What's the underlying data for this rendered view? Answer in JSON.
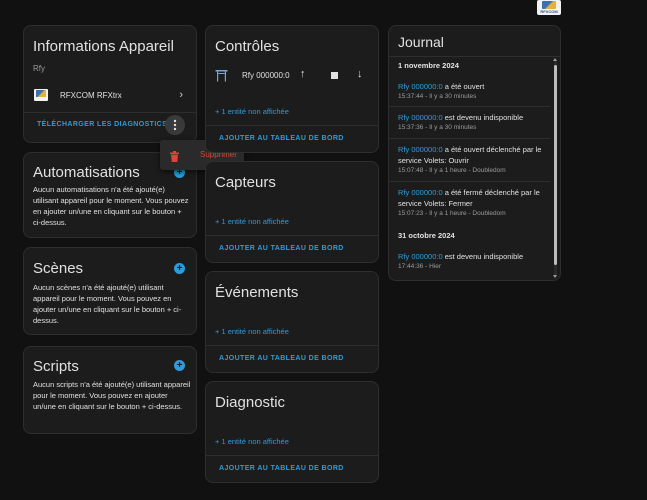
{
  "top_logo_label": "RFXCOM",
  "info_card": {
    "title": "Informations Appareil",
    "model": "Rfy",
    "device_name": "RFXCOM RFXtrx",
    "download_label": "TÉLÉCHARGER LES DIAGNOSTICS"
  },
  "menu": {
    "delete_label": "Supprimer"
  },
  "automations": {
    "title": "Automatisations",
    "text": "Aucun automatisations n'a été ajouté(e) utilisant appareil pour le moment. Vous pouvez en ajouter un/une en cliquant sur le bouton + ci-dessus."
  },
  "scenes": {
    "title": "Scènes",
    "text": "Aucun scènes n'a été ajouté(e) utilisant appareil pour le moment. Vous pouvez en ajouter un/une en cliquant sur le bouton + ci-dessus."
  },
  "scripts": {
    "title": "Scripts",
    "text": "Aucun scripts n'a été ajouté(e) utilisant appareil pour le moment. Vous pouvez en ajouter un/une en cliquant sur le bouton + ci-dessus."
  },
  "controls": {
    "title": "Contrôles",
    "entity_name": "Rfy 000000:0",
    "hidden_label": "+ 1 entité non affichée",
    "add_label": "AJOUTER AU TABLEAU DE BORD"
  },
  "sensors": {
    "title": "Capteurs",
    "hidden_label": "+ 1 entité non affichée",
    "add_label": "AJOUTER AU TABLEAU DE BORD"
  },
  "events": {
    "title": "Événements",
    "hidden_label": "+ 1 entité non affichée",
    "add_label": "AJOUTER AU TABLEAU DE BORD"
  },
  "diagnostic": {
    "title": "Diagnostic",
    "hidden_label": "+ 1 entité non affichée",
    "add_label": "AJOUTER AU TABLEAU DE BORD"
  },
  "journal": {
    "title": "Journal",
    "date1": "1 novembre 2024",
    "date2": "31 octobre 2024",
    "entries": [
      {
        "entity": "Rfy 000000:0",
        "text": "a été ouvert",
        "text2": "",
        "meta": "15:37:44 - Il y a 30 minutes"
      },
      {
        "entity": "Rfy 000000:0",
        "text": "est devenu indisponible",
        "text2": "",
        "meta": "15:37:36 - Il y a 30 minutes"
      },
      {
        "entity": "Rfy 000000:0",
        "text": "a été ouvert déclenché par le",
        "text2": "service Volets: Ouvrir",
        "meta": "15:07:48 - Il y a 1 heure - Doubledom"
      },
      {
        "entity": "Rfy 000000:0",
        "text": "a été fermé déclenché par le",
        "text2": "service Volets: Fermer",
        "meta": "15:07:23 - Il y a 1 heure - Doubledom"
      },
      {
        "entity": "Rfy 000000:0",
        "text": "est devenu indisponible",
        "text2": "",
        "meta": "17:44:36 - Hier"
      }
    ]
  }
}
